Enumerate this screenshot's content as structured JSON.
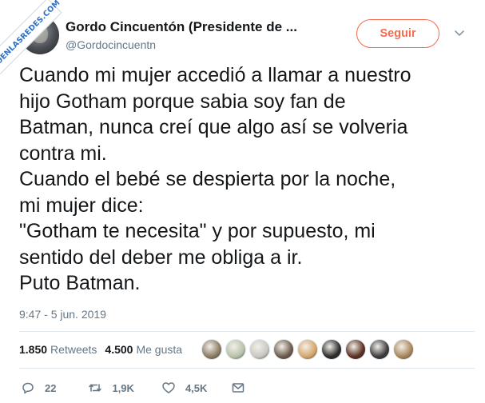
{
  "watermark": {
    "text": "VISTOENLASREDES.COM"
  },
  "header": {
    "display_name": "Gordo Cincuentón (Presidente de ...",
    "handle": "@Gordocincuentn",
    "follow_label": "Seguir",
    "accent_color": "#f26c4f"
  },
  "tweet": {
    "lines": [
      "Cuando mi mujer accedió a llamar a nuestro",
      "hijo Gotham porque sabia soy fan de",
      "Batman, nunca creí que algo así se volveria",
      "contra mi.",
      "Cuando el bebé se despierta por la noche,",
      "mi mujer dice:",
      "\"Gotham te necesita\" y por supuesto, mi",
      "sentido del deber me obliga a ir.",
      "Puto Batman."
    ],
    "timestamp": "9:47 - 5 jun. 2019"
  },
  "stats": {
    "retweets_count": "1.850",
    "retweets_label": "Retweets",
    "likes_count": "4.500",
    "likes_label": "Me gusta",
    "liker_colors": [
      "#8a7a63",
      "#b7c2a8",
      "#c8c8c0",
      "#6b5a4a",
      "#d4a56a",
      "#2a2a2a",
      "#5a2e20",
      "#3b3b3b",
      "#a9865a"
    ]
  },
  "actions": {
    "reply_count": "22",
    "retweet_count": "1,9K",
    "like_count": "4,5K",
    "icons": [
      "reply-icon",
      "retweet-icon",
      "heart-icon",
      "envelope-icon"
    ]
  }
}
